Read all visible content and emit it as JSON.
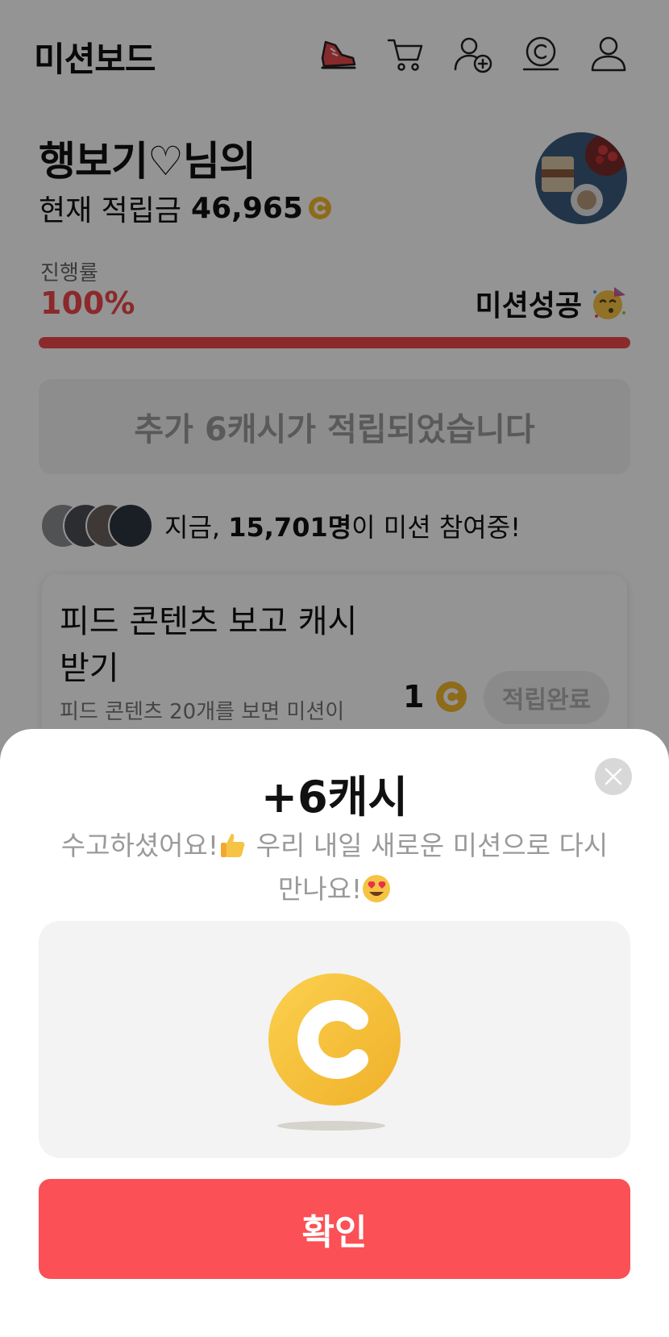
{
  "header": {
    "title": "미션보드",
    "icons": [
      "shoe-icon",
      "cart-icon",
      "add-friend-icon",
      "cash-icon",
      "profile-icon"
    ]
  },
  "user": {
    "greeting": "행보기♡님의",
    "balance_label": "현재 적립금",
    "balance_value": "46,965"
  },
  "progress": {
    "label": "진행률",
    "value_text": "100%",
    "value": 100,
    "status": "미션성공"
  },
  "notice": "추가 6캐시가 적립되었습니다",
  "participants": {
    "prefix": "지금, ",
    "count": "15,701명",
    "suffix": "이 미션 참여중!"
  },
  "mission": {
    "title": "피드 콘텐츠 보고 캐시 받기",
    "description": "피드 콘텐츠 20개를 보면 미션이",
    "reward": "1",
    "button": "적립완료"
  },
  "modal": {
    "title": "+6캐시",
    "message_part1": "수고하셨어요!",
    "message_part2": " 우리 내일 새로운 미션으로 다시 만나요!",
    "confirm": "확인"
  },
  "colors": {
    "accent": "#f0474a",
    "button": "#fb5055",
    "coin": "#f5b82e"
  }
}
